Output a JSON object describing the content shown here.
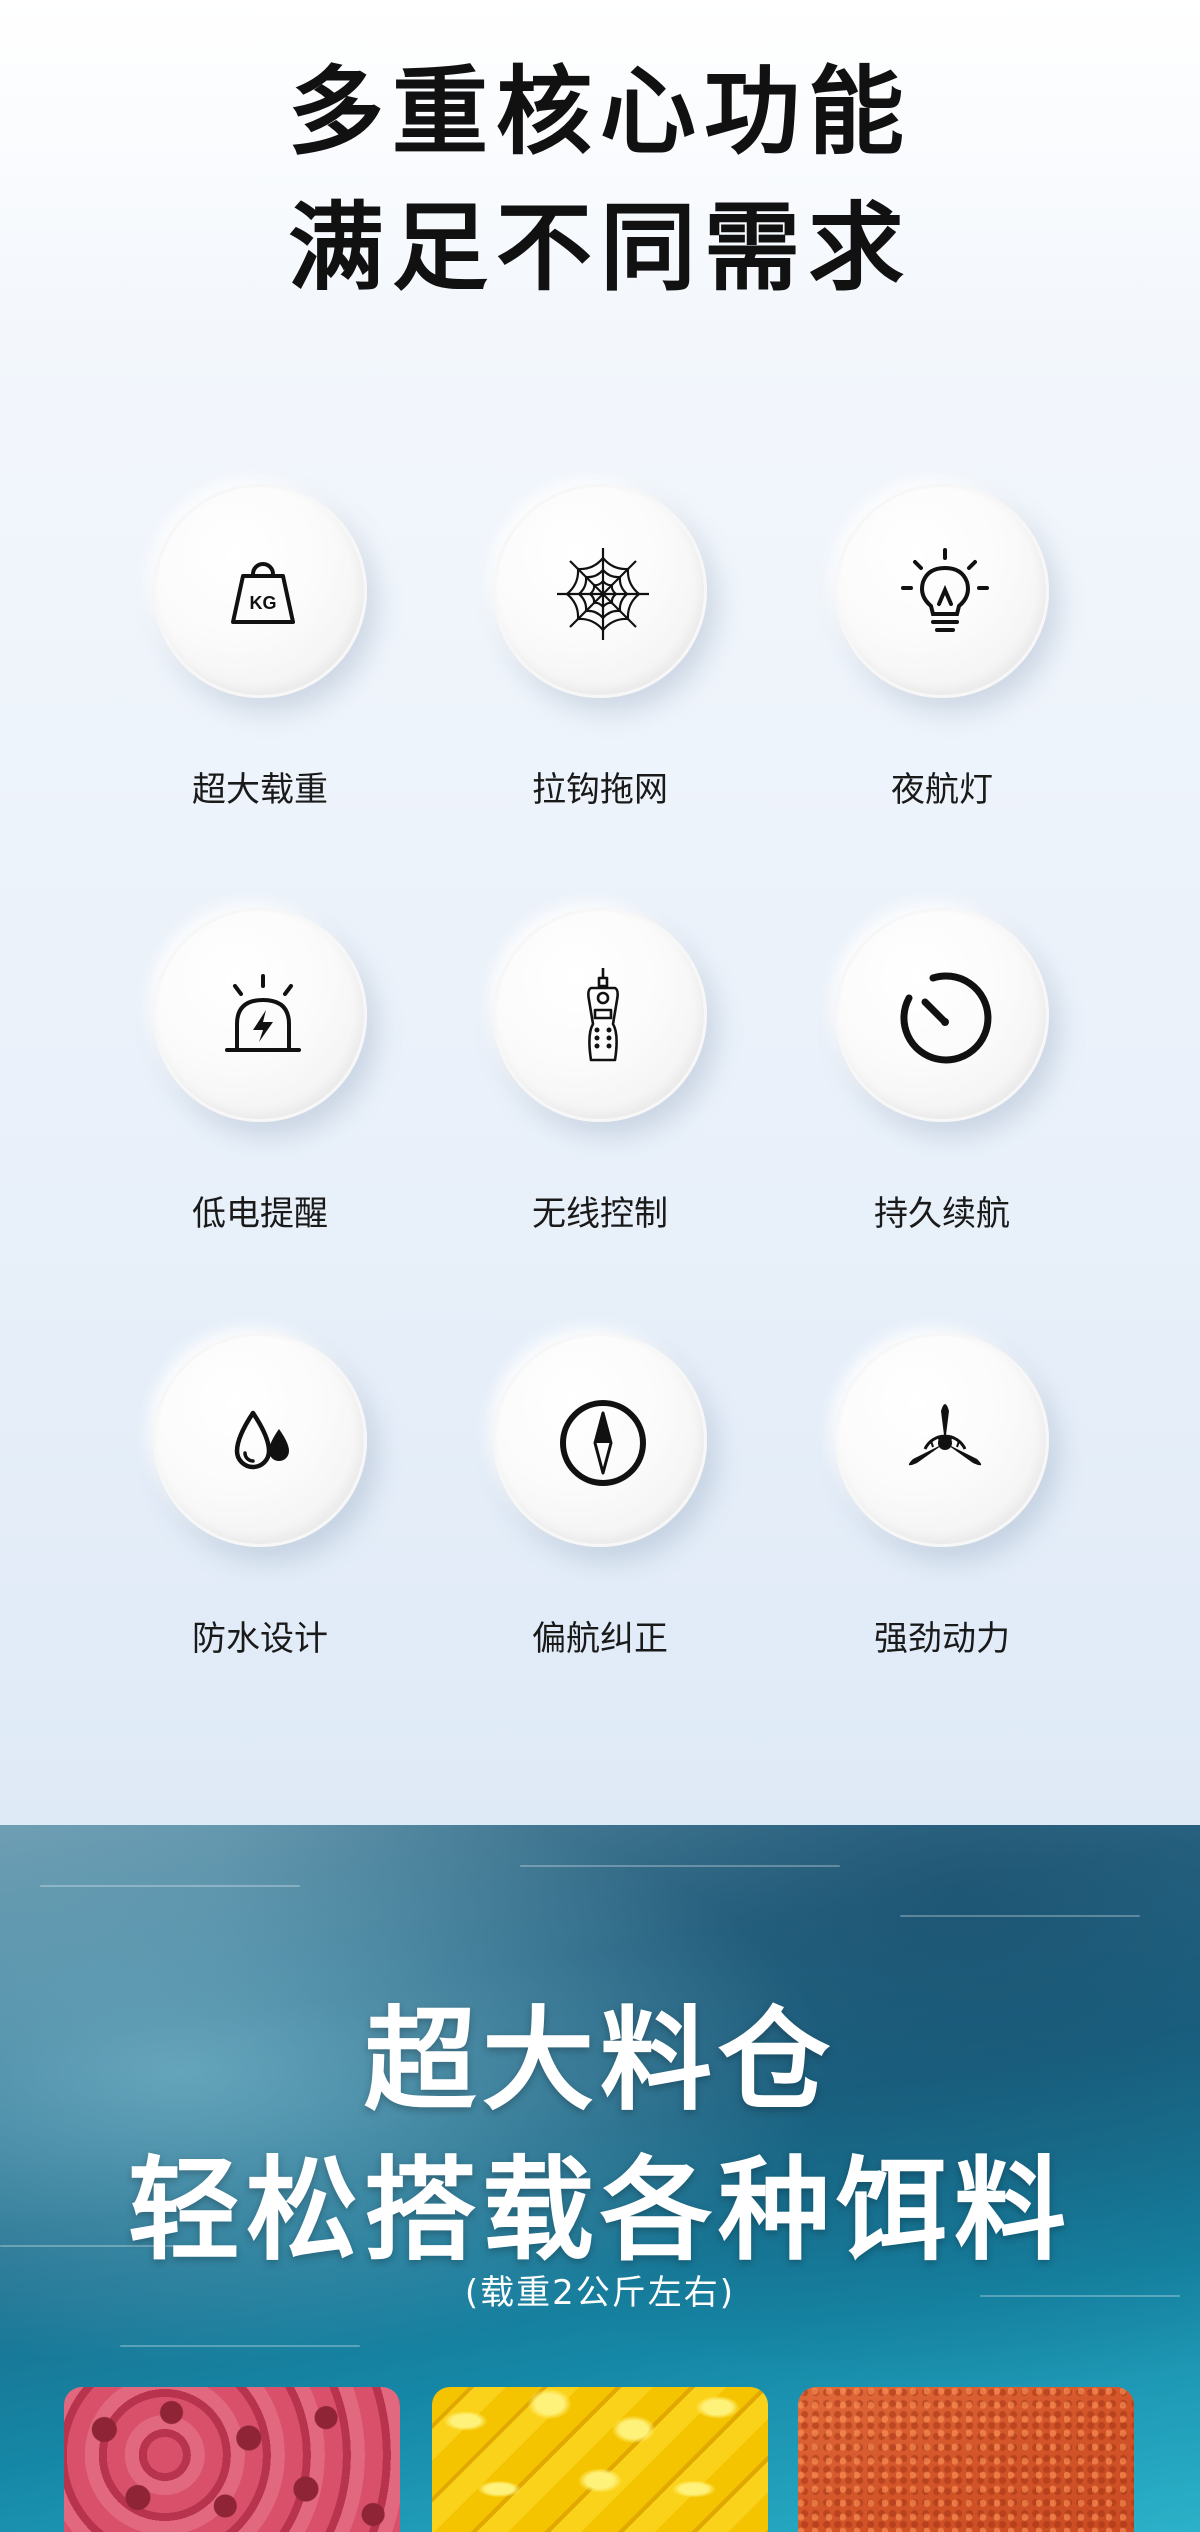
{
  "header": {
    "line1": "多重核心功能",
    "line2": "满足不同需求"
  },
  "features": [
    {
      "label": "超大载重",
      "icon": "kg-weight-icon"
    },
    {
      "label": "拉钩拖网",
      "icon": "spider-web-icon"
    },
    {
      "label": "夜航灯",
      "icon": "light-bulb-icon"
    },
    {
      "label": "低电提醒",
      "icon": "low-battery-alarm-icon"
    },
    {
      "label": "无线控制",
      "icon": "remote-control-icon"
    },
    {
      "label": "持久续航",
      "icon": "stopwatch-icon"
    },
    {
      "label": "防水设计",
      "icon": "water-drops-icon"
    },
    {
      "label": "偏航纠正",
      "icon": "compass-icon"
    },
    {
      "label": "强劲动力",
      "icon": "propeller-icon"
    }
  ],
  "kg_badge": "KG",
  "bait_section": {
    "title_line1": "超大料仓",
    "title_line2": "轻松搭载各种饵料",
    "note": "(载重2公斤左右)",
    "baits": [
      {
        "name": "red-pellet-bait"
      },
      {
        "name": "corn-bait"
      },
      {
        "name": "powder-bait"
      }
    ]
  },
  "colors": {
    "heading": "#111111",
    "icon_stroke": "#111111",
    "ocean_dark": "#1c6a8a",
    "ocean_light": "#2bb1c9"
  }
}
